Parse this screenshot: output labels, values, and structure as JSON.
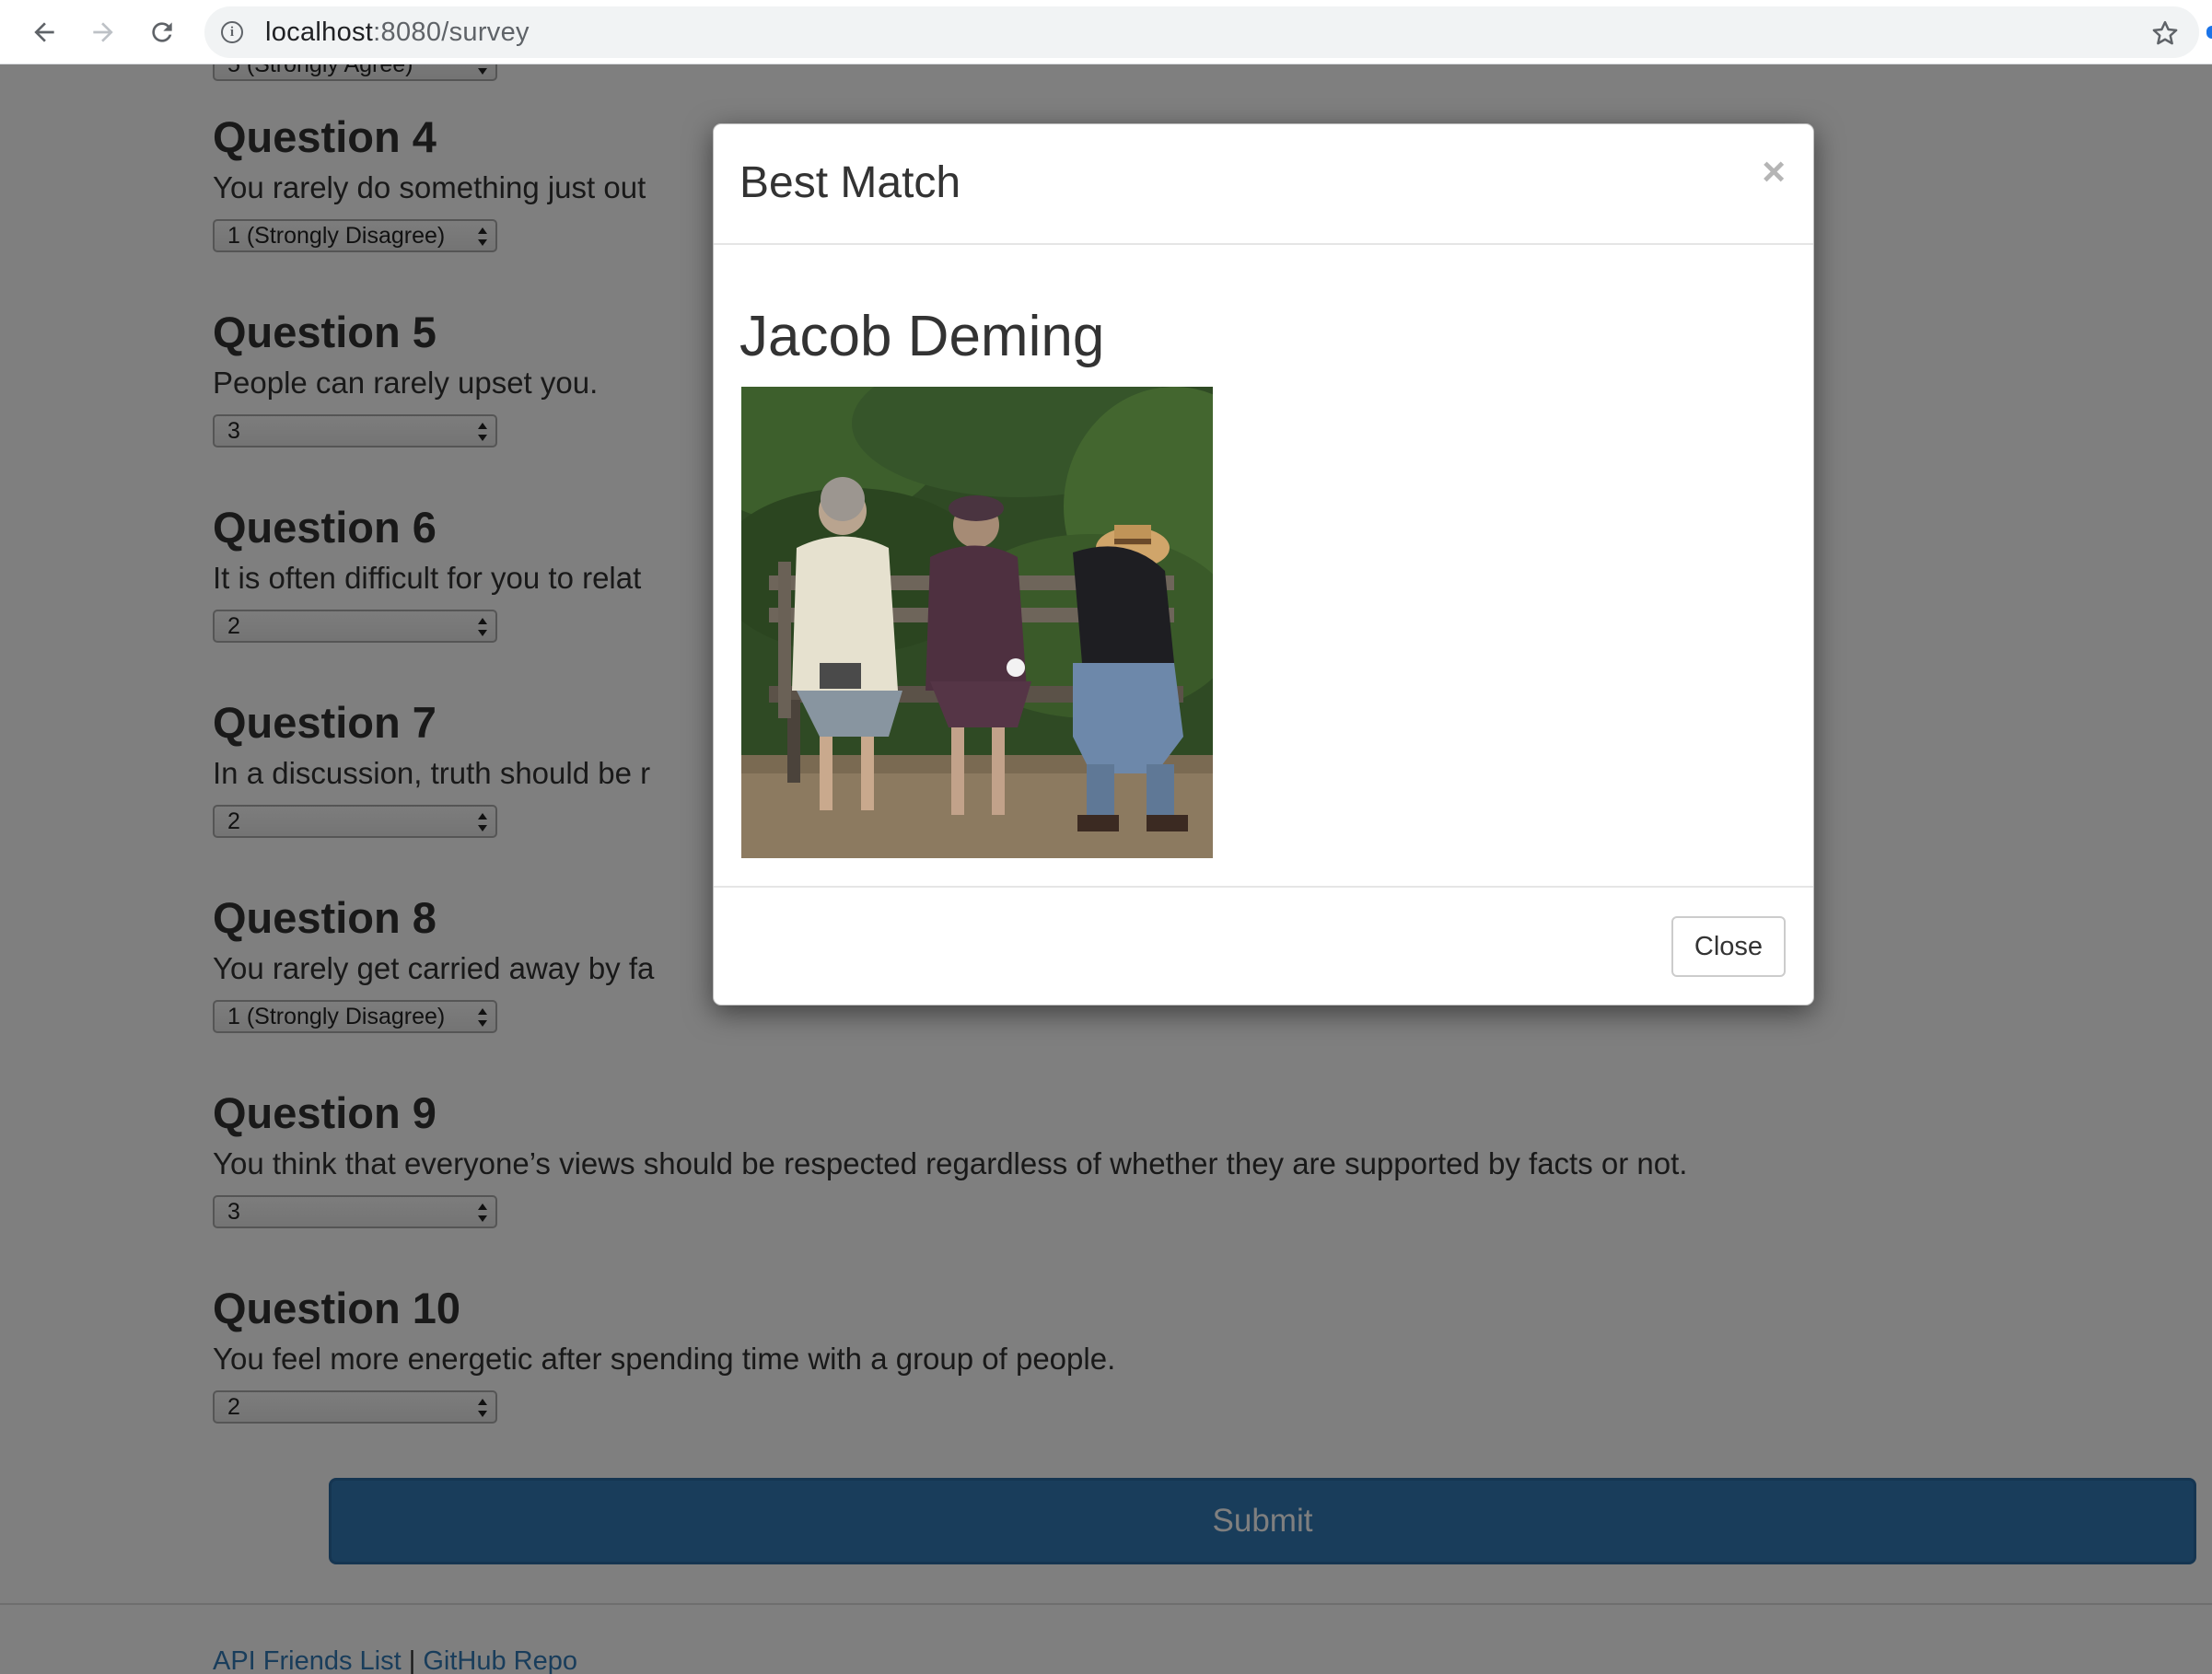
{
  "browser": {
    "url_host": "localhost",
    "url_path": ":8080/survey"
  },
  "survey": {
    "top_partial_value": "5 (Strongly Agree)",
    "questions": [
      {
        "title": "Question 4",
        "text": "You rarely do something just out",
        "value": "1 (Strongly Disagree)"
      },
      {
        "title": "Question 5",
        "text": "People can rarely upset you.",
        "value": "3"
      },
      {
        "title": "Question 6",
        "text": "It is often difficult for you to relat",
        "value": "2"
      },
      {
        "title": "Question 7",
        "text": "In a discussion, truth should be r",
        "value": "2"
      },
      {
        "title": "Question 8",
        "text": "You rarely get carried away by fa",
        "value": "1 (Strongly Disagree)"
      },
      {
        "title": "Question 9",
        "text": "You think that everyone’s views should be respected regardless of whether they are supported by facts or not.",
        "value": "3"
      },
      {
        "title": "Question 10",
        "text": "You feel more energetic after spending time with a group of people.",
        "value": "2"
      }
    ],
    "submit_label": "Submit"
  },
  "footer": {
    "link_api": "API Friends List",
    "separator": "|",
    "link_repo": "GitHub Repo"
  },
  "modal": {
    "title": "Best Match",
    "close_x": "×",
    "match_name": "Jacob Deming",
    "close_label": "Close"
  }
}
